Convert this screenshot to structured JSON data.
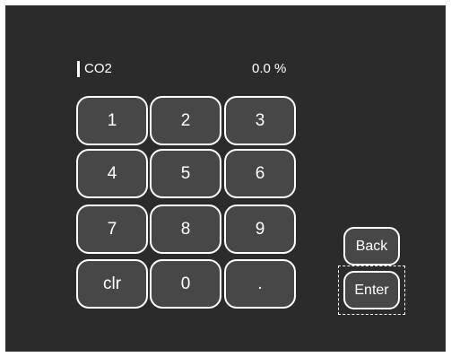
{
  "entry": {
    "label": "CO2",
    "value": "0.0 %"
  },
  "keypad": {
    "keys": [
      "1",
      "2",
      "3",
      "4",
      "5",
      "6",
      "7",
      "8",
      "9",
      "clr",
      "0",
      "."
    ]
  },
  "actions": {
    "back_label": "Back",
    "enter_label": "Enter"
  },
  "colors": {
    "background": "#2b2b2b",
    "key_fill": "#474747",
    "outline": "#ffffff"
  }
}
